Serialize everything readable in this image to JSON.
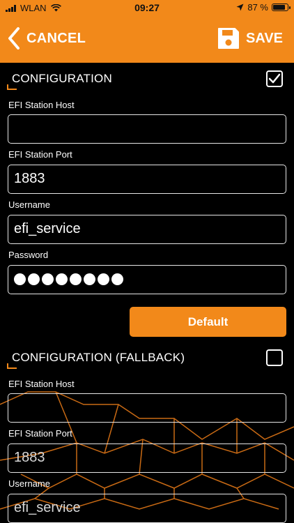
{
  "status_bar": {
    "carrier": "WLAN",
    "time": "09:27",
    "battery": "87 %",
    "battery_level": 0.87
  },
  "nav": {
    "cancel_label": "CANCEL",
    "save_label": "SAVE"
  },
  "config": {
    "title": "CONFIGURATION",
    "checked": true,
    "host_label": "EFI Station Host",
    "host_value": "",
    "port_label": "EFI Station Port",
    "port_value": "1883",
    "username_label": "Username",
    "username_value": "efi_service",
    "password_label": "Password",
    "password_masked_length": 8,
    "default_button": "Default"
  },
  "fallback": {
    "title": "CONFIGURATION (FALLBACK)",
    "checked": false,
    "host_label": "EFI Station Host",
    "host_value": "",
    "port_label": "EFI Station Port",
    "port_value": "1883",
    "username_label": "Username",
    "username_value": "efi_service"
  },
  "colors": {
    "accent": "#f2891a",
    "background": "#000000",
    "field_border": "#e6e6e6"
  },
  "icons": [
    "signal-bars-icon",
    "wifi-icon",
    "location-arrow-icon",
    "battery-icon",
    "chevron-left-icon",
    "floppy-disk-icon",
    "checkmark-icon"
  ]
}
